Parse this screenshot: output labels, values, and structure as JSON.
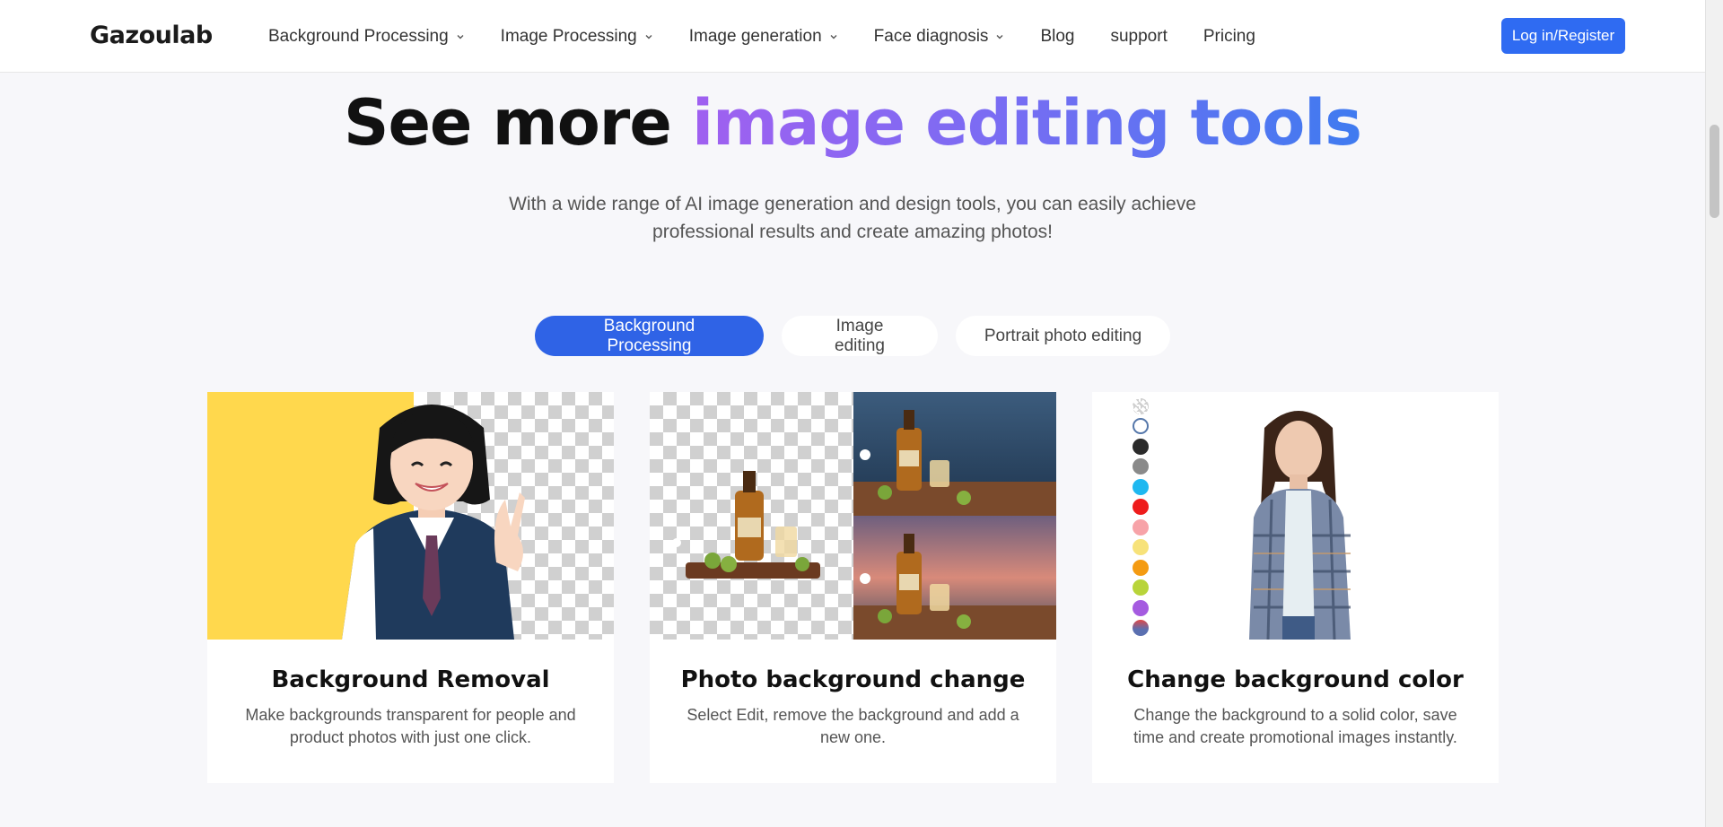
{
  "header": {
    "logo": "Gazoulab",
    "nav": [
      {
        "label": "Background Processing",
        "has_dropdown": true
      },
      {
        "label": "Image Processing",
        "has_dropdown": true
      },
      {
        "label": "Image generation",
        "has_dropdown": true
      },
      {
        "label": "Face diagnosis",
        "has_dropdown": true
      },
      {
        "label": "Blog",
        "has_dropdown": false
      },
      {
        "label": "support",
        "has_dropdown": false
      },
      {
        "label": "Pricing",
        "has_dropdown": false
      }
    ],
    "login_label": "Log in/Register"
  },
  "hero": {
    "title_plain": "See more ",
    "title_highlight": "image editing tools",
    "subtitle": "With a wide range of AI image generation and design tools, you can easily achieve professional results and create amazing photos!"
  },
  "tabs": [
    {
      "label": "Background Processing",
      "active": true
    },
    {
      "label": "Image editing",
      "active": false
    },
    {
      "label": "Portrait photo editing",
      "active": false
    }
  ],
  "cards": [
    {
      "title": "Background Removal",
      "description": "Make backgrounds transparent for people and product photos with just one click."
    },
    {
      "title": "Photo background change",
      "description": "Select Edit, remove the background and add a new one."
    },
    {
      "title": "Change background color",
      "description": "Change the background to a solid color, save time and create promotional images instantly."
    }
  ],
  "colors": {
    "accent": "#2f6bf2",
    "tab_active": "#2f63e6",
    "swatches": [
      "transparent",
      "#ffffff",
      "#2b2b2b",
      "#8a8a8a",
      "#1fb8f0",
      "#ee1c1c",
      "#f7a3a8",
      "#f7e27a",
      "#f49b12",
      "#b8d43a",
      "#a55be0",
      "#5a6fb0"
    ]
  }
}
